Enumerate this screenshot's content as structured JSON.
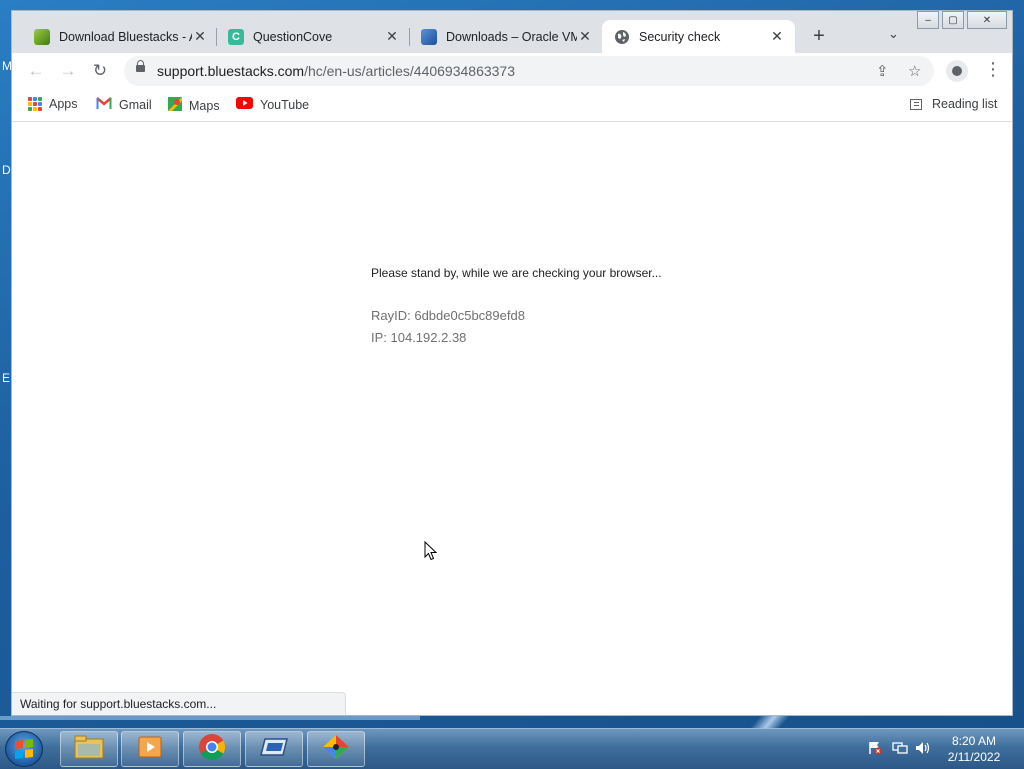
{
  "desktop": {
    "edge_letters": [
      "M",
      "D",
      "E"
    ]
  },
  "tabs": [
    {
      "label": "Download Bluestacks - A",
      "icon": "bluestacks-icon",
      "color": "#6fa32c"
    },
    {
      "label": "QuestionCove",
      "icon": "questioncove-icon",
      "color": "#3ab89a"
    },
    {
      "label": "Downloads – Oracle VM",
      "icon": "virtualbox-icon",
      "color": "#2a63b6"
    },
    {
      "label": "Security check",
      "icon": "globe-icon",
      "active": true
    }
  ],
  "window_controls": {
    "minimize": "‒",
    "maximize": "▢",
    "close": "✕"
  },
  "address_bar": {
    "domain": "support.bluestacks.com",
    "path": "/hc/en-us/articles/4406934863373"
  },
  "bookmarks": [
    {
      "label": "Apps",
      "icon": "apps-grid-icon"
    },
    {
      "label": "Gmail",
      "icon": "gmail-icon"
    },
    {
      "label": "Maps",
      "icon": "maps-icon"
    },
    {
      "label": "YouTube",
      "icon": "youtube-icon"
    }
  ],
  "reading_list": "Reading list",
  "page": {
    "message": "Please stand by, while we are checking your browser...",
    "ray_id": "RayID: 6dbde0c5bc89efd8",
    "ip": "IP: 104.192.2.38"
  },
  "status_bar": "Waiting for support.bluestacks.com...",
  "taskbar": {
    "apps": [
      "file-explorer",
      "media-player",
      "chrome",
      "virtualbox",
      "bluestacks"
    ],
    "clock_time": "8:20 AM",
    "clock_date": "2/11/2022"
  },
  "colors": {
    "chrome_frame": "#dee1e6",
    "omnibox": "#f1f3f4",
    "accent_blue": "#1a73e8"
  }
}
